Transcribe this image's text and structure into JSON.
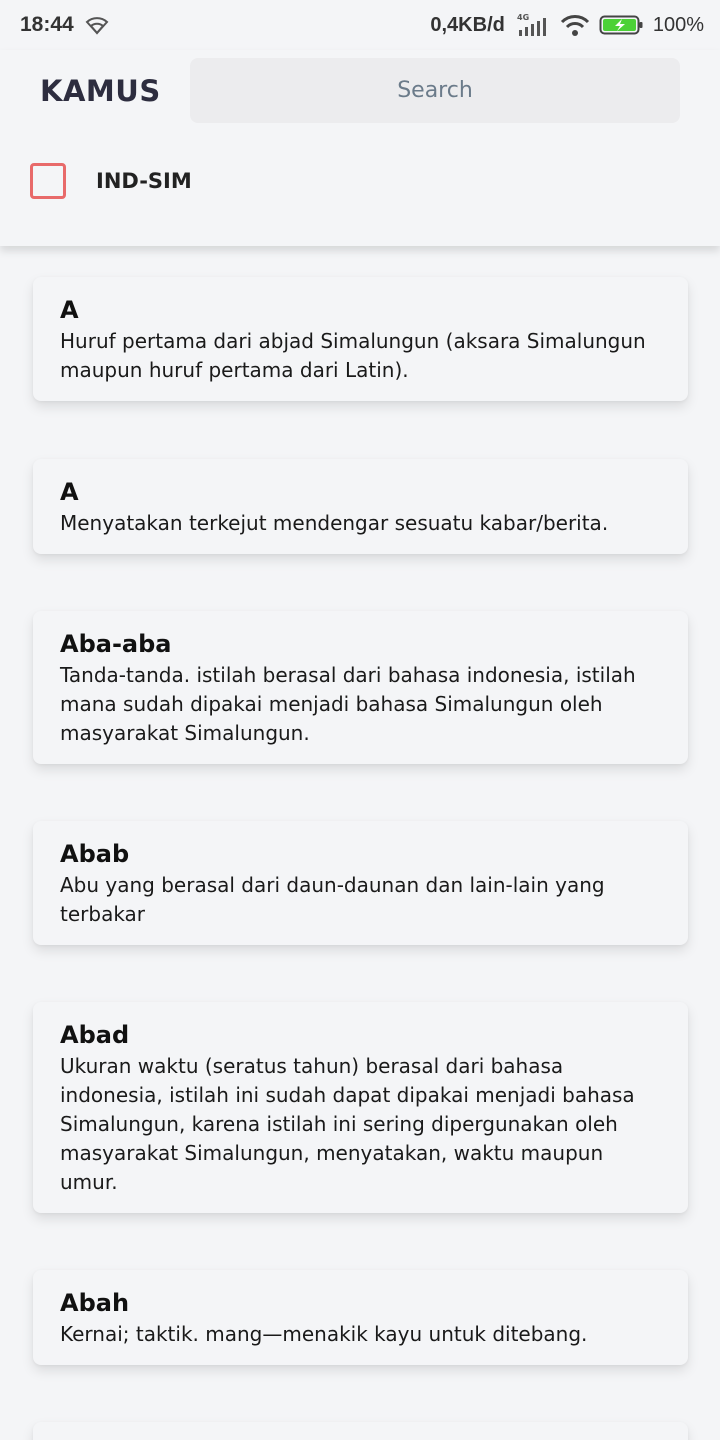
{
  "status_bar": {
    "time": "18:44",
    "speed": "0,4KB/d",
    "network": "4G",
    "battery": "100%",
    "icons": [
      "wifi-icon",
      "signal-icon",
      "battery-charging-icon"
    ]
  },
  "header": {
    "title": "KAMUS",
    "search_placeholder": "Search",
    "checkbox_label": "IND-SIM",
    "checkbox_checked": false
  },
  "entries": [
    {
      "word": "A",
      "definition": "Huruf pertama dari abjad Simalungun (aksara Simalungun maupun huruf pertama dari Latin)."
    },
    {
      "word": "A",
      "definition": "Menyatakan terkejut mendengar sesuatu kabar/berita."
    },
    {
      "word": "Aba-aba",
      "definition": "Tanda-tanda. istilah berasal dari bahasa indonesia, istilah mana sudah dipakai menjadi bahasa Simalungun oleh masyarakat Simalungun."
    },
    {
      "word": "Abab",
      "definition": "Abu yang berasal dari daun-daunan dan lain-lain yang terbakar"
    },
    {
      "word": "Abad",
      "definition": "Ukuran waktu (seratus tahun) berasal dari bahasa indonesia, istilah ini sudah dapat dipakai menjadi bahasa Simalungun, karena istilah ini sering dipergunakan oleh masyarakat Simalungun, menyatakan, waktu maupun umur."
    },
    {
      "word": "Abah",
      "definition": "Kernai; taktik. mang—menakik kayu untuk ditebang."
    }
  ],
  "colors": {
    "background": "#f4f5f7",
    "checkbox_border": "#e86a6a",
    "title": "#2d2d3f",
    "search_bg": "#ececee",
    "battery_green": "#4cd137"
  }
}
